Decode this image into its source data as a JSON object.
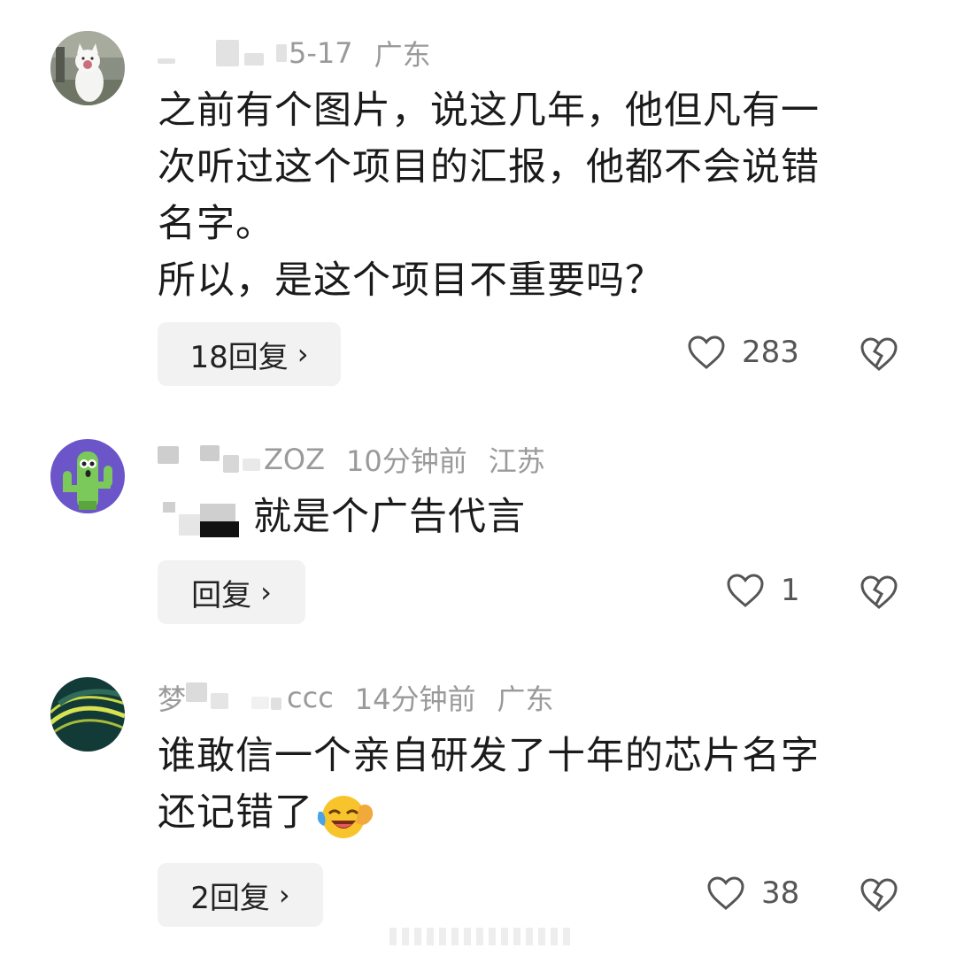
{
  "comments": [
    {
      "user": "",
      "date": "5-17",
      "location": "广东",
      "lines": [
        "之前有个图片，说这几年，他但凡有一",
        "次听过这个项目的汇报，他都不会说错",
        "名字。",
        "所以，是这个项目不重要吗？"
      ],
      "reply_label": "18回复",
      "likes": "283",
      "avatar_icon": "cat-avatar-icon"
    },
    {
      "user": "ZOZ",
      "date": "10分钟前",
      "location": "江苏",
      "text": "就是个广告代言",
      "reply_label": "回复",
      "likes": "1",
      "avatar_icon": "cactus-avatar-icon"
    },
    {
      "user": "梦",
      "user_suffix": "ccc",
      "date": "14分钟前",
      "location": "广东",
      "lines": [
        "谁敢信一个亲自研发了十年的芯片名字",
        "还记错了"
      ],
      "reply_label": "2回复",
      "likes": "38",
      "avatar_icon": "leaf-avatar-icon",
      "emoji": "laughing-crying-emoji-icon"
    }
  ],
  "icons": {
    "like": "heart-outline-icon",
    "dislike": "broken-heart-icon",
    "chevron": "chevron-right-icon"
  },
  "colors": {
    "text": "#1b1b1b",
    "meta": "#9a9a9a",
    "button_bg": "#f2f2f2",
    "icon": "#555555"
  }
}
